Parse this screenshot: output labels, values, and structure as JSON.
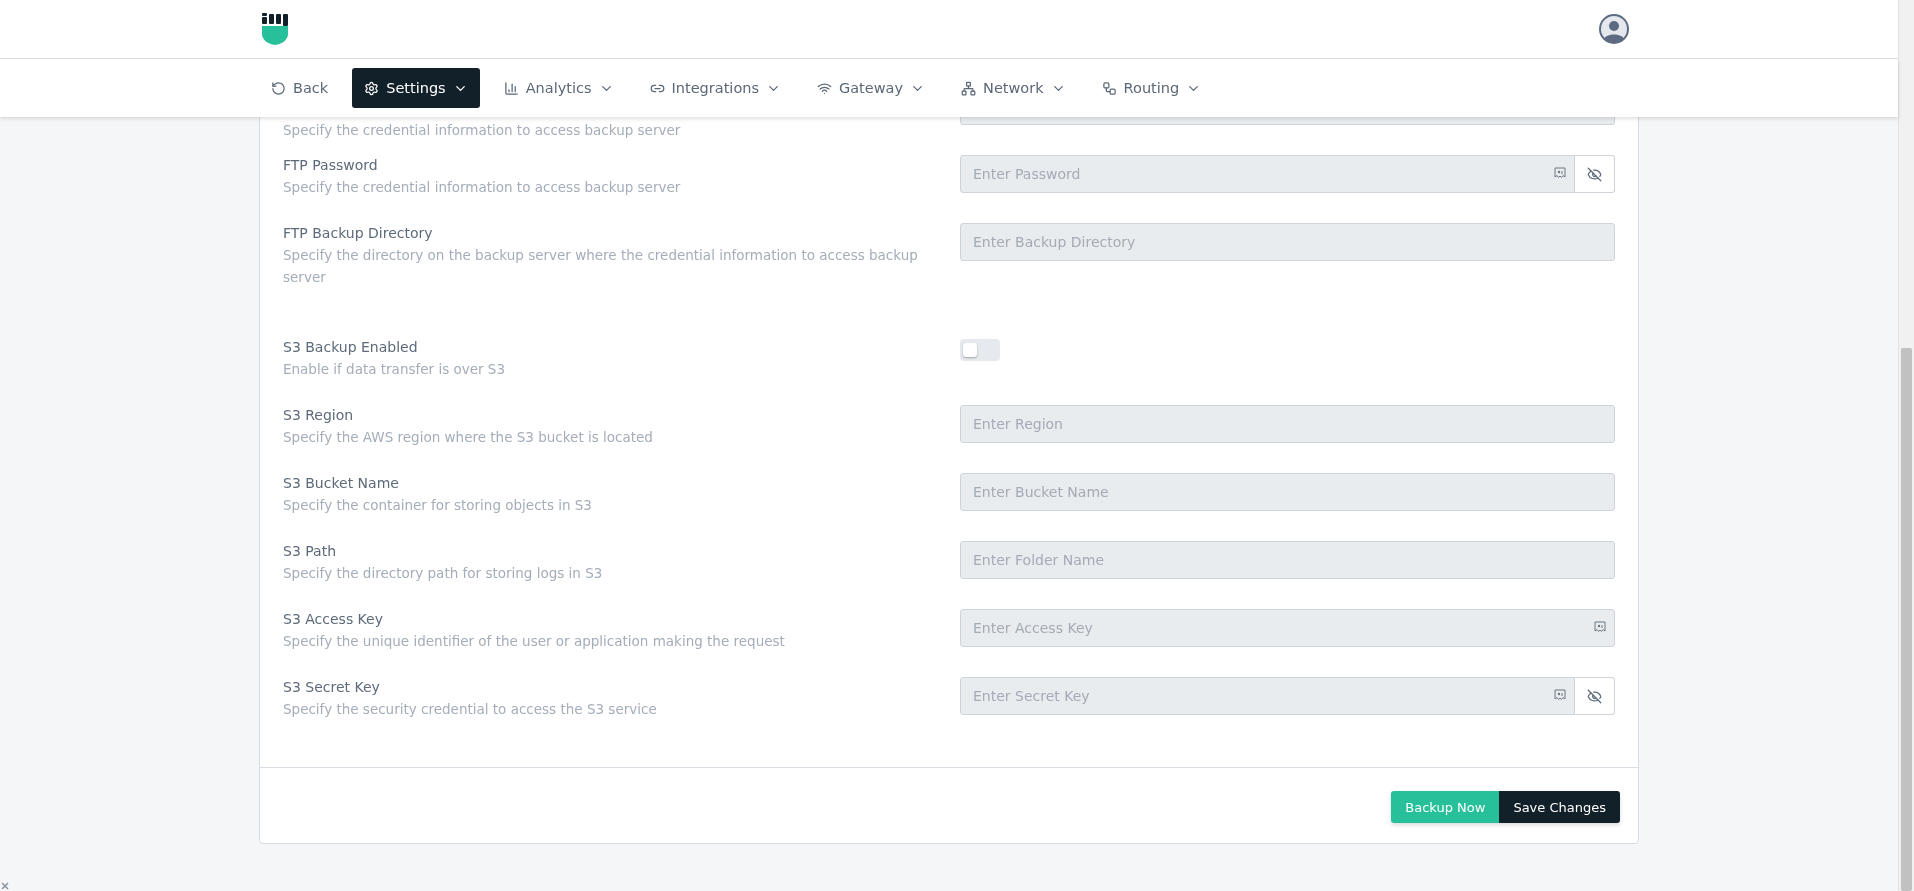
{
  "nav": [
    {
      "label": "Back",
      "selected": false,
      "dropdown": false
    },
    {
      "label": "Settings",
      "selected": true,
      "dropdown": true
    },
    {
      "label": "Analytics",
      "selected": false,
      "dropdown": true
    },
    {
      "label": "Integrations",
      "selected": false,
      "dropdown": true
    },
    {
      "label": "Gateway",
      "selected": false,
      "dropdown": true
    },
    {
      "label": "Network",
      "selected": false,
      "dropdown": true
    },
    {
      "label": "Routing",
      "selected": false,
      "dropdown": true
    }
  ],
  "sections": [
    {
      "rows": [
        {
          "description": "Specify the credential information to access backup server",
          "kind": "text"
        },
        {
          "label": "FTP Password",
          "description": "Specify the credential information to access backup server",
          "kind": "password",
          "placeholder": "Enter Password"
        },
        {
          "label": "FTP Backup Directory",
          "description": "Specify the directory on the backup server where the credential information to access backup server",
          "kind": "text",
          "placeholder": "Enter Backup Directory"
        }
      ]
    },
    {
      "rows": [
        {
          "label": "S3 Backup Enabled",
          "description": "Enable if data transfer is over S3",
          "kind": "toggle",
          "on": false
        },
        {
          "label": "S3 Region",
          "description": "Specify the AWS region where the S3 bucket is located",
          "kind": "text",
          "placeholder": "Enter Region"
        },
        {
          "label": "S3 Bucket Name",
          "description": "Specify the container for storing objects in S3",
          "kind": "text",
          "placeholder": "Enter Bucket Name"
        },
        {
          "label": "S3 Path",
          "description": "Specify the directory path for storing logs in S3",
          "kind": "text",
          "placeholder": "Enter Folder Name"
        },
        {
          "label": "S3 Access Key",
          "description": "Specify the unique identifier of the user or application making the request",
          "kind": "key",
          "placeholder": "Enter Access Key"
        },
        {
          "label": "S3 Secret Key",
          "description": "Specify the security credential to access the S3 service",
          "kind": "password",
          "placeholder": "Enter Secret Key"
        }
      ]
    }
  ],
  "buttons": [
    {
      "label": "Backup Now",
      "kind": "primary"
    },
    {
      "label": "Save Changes",
      "kind": "dark"
    }
  ]
}
